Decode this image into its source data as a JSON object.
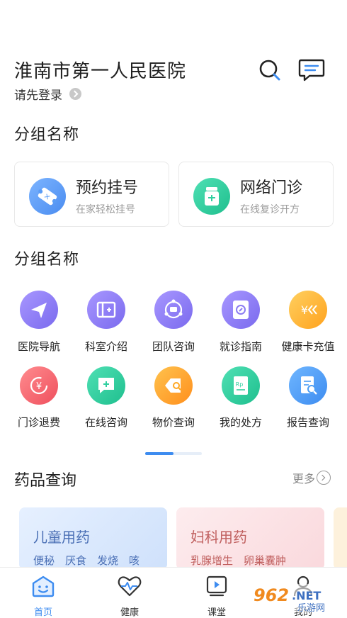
{
  "header": {
    "hospital_name": "淮南市第一人民医院",
    "login_text": "请先登录",
    "search_icon": "search-icon",
    "message_icon": "message-icon"
  },
  "section1": {
    "title": "分组名称",
    "cards": [
      {
        "title": "预约挂号",
        "subtitle": "在家轻松挂号",
        "icon": "ticket-icon",
        "color": "#5a9cf6"
      },
      {
        "title": "网络门诊",
        "subtitle": "在线复诊开方",
        "icon": "medicine-bottle-icon",
        "color": "#2fcf9f"
      }
    ]
  },
  "section2": {
    "title": "分组名称",
    "items": [
      {
        "label": "医院导航",
        "icon": "navigation-icon",
        "color": "#8c7cf2"
      },
      {
        "label": "科室介绍",
        "icon": "department-icon",
        "color": "#8c7cf2"
      },
      {
        "label": "团队咨询",
        "icon": "team-chat-icon",
        "color": "#8c7cf2"
      },
      {
        "label": "就诊指南",
        "icon": "guide-icon",
        "color": "#8c7cf2"
      },
      {
        "label": "健康卡充值",
        "icon": "card-recharge-icon",
        "color": "#ffb128"
      },
      {
        "label": "门诊退费",
        "icon": "refund-icon",
        "color": "#f5666f"
      },
      {
        "label": "在线咨询",
        "icon": "online-consult-icon",
        "color": "#2fcf9f"
      },
      {
        "label": "物价查询",
        "icon": "price-tag-icon",
        "color": "#ffa722"
      },
      {
        "label": "我的处方",
        "icon": "prescription-icon",
        "color": "#2fcf9f"
      },
      {
        "label": "报告查询",
        "icon": "report-icon",
        "color": "#4b9df5"
      }
    ],
    "page_indicator": {
      "current": 1,
      "total": 2
    }
  },
  "drugs": {
    "title": "药品查询",
    "more_label": "更多",
    "cards": [
      {
        "title": "儿童用药",
        "subtitle": "便秘　厌食　发烧　咳",
        "title_color": "#4a6fb5",
        "bg": "#e3eefd"
      },
      {
        "title": "妇科用药",
        "subtitle": "乳腺增生　卵巢囊肿",
        "title_color": "#c0605f",
        "bg": "#fde8ea"
      }
    ]
  },
  "tabbar": {
    "tabs": [
      {
        "label": "首页",
        "icon": "home-smile-icon",
        "active": true
      },
      {
        "label": "健康",
        "icon": "heartbeat-icon",
        "active": false
      },
      {
        "label": "课堂",
        "icon": "video-class-icon",
        "active": false
      },
      {
        "label": "我的",
        "icon": "profile-icon",
        "active": false
      }
    ]
  },
  "watermark": {
    "logo_text": "962.NET",
    "sub_text": "乐游网"
  }
}
